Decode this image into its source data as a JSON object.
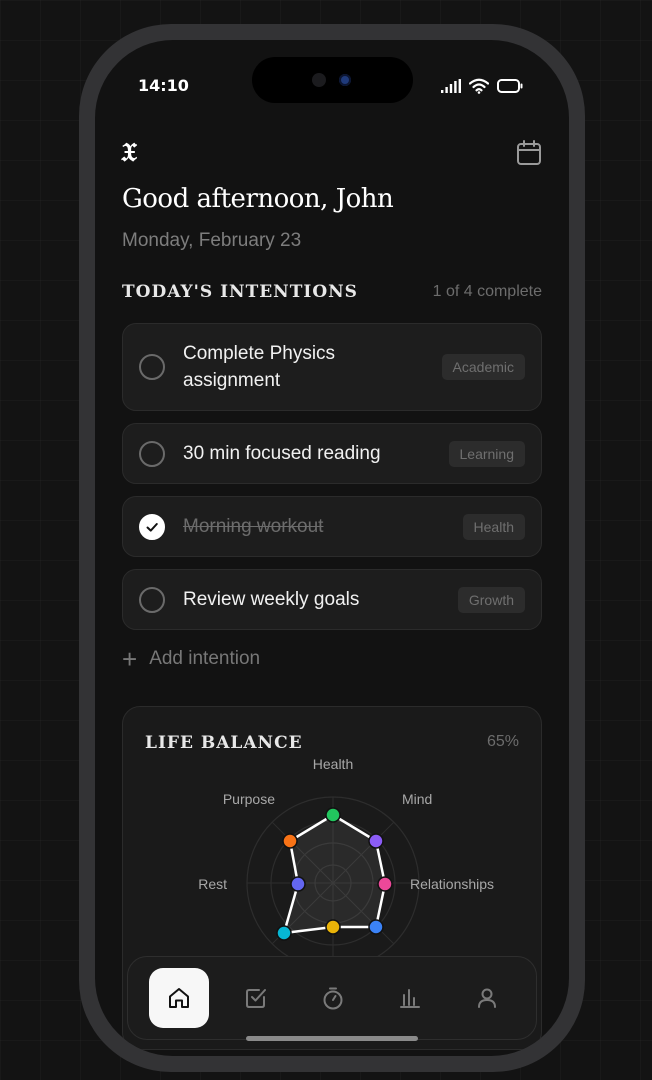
{
  "status": {
    "time": "14:10"
  },
  "header": {
    "logo": "𝔛",
    "greeting": "Good afternoon, John",
    "date": "Monday, February 23",
    "calendar_icon": "calendar-icon"
  },
  "intentions": {
    "title": "TODAY'S INTENTIONS",
    "progress": "1 of 4 complete",
    "items": [
      {
        "line1": "Complete Physics",
        "line2": "assignment",
        "tag": "Academic",
        "done": false
      },
      {
        "line1": "30 min focused reading",
        "tag": "Learning",
        "done": false
      },
      {
        "line1": "Morning workout",
        "tag": "Health",
        "done": true
      },
      {
        "line1": "Review weekly goals",
        "tag": "Growth",
        "done": false
      }
    ],
    "add_label": "Add intention"
  },
  "balance": {
    "title": "LIFE BALANCE",
    "percent": "65%",
    "labels": {
      "health": "Health",
      "mind": "Mind",
      "relationships": "Relationships",
      "rest": "Rest",
      "purpose": "Purpose"
    },
    "colors": {
      "health": "#22c55e",
      "mind": "#8b5cf6",
      "relationships": "#ec4899",
      "bottom_right": "#3b82f6",
      "bottom": "#eab308",
      "bottom_left": "#06b6d4",
      "rest": "#6366f1",
      "purpose": "#f97316"
    }
  },
  "nav": {
    "items": [
      "home-icon",
      "checkbox-icon",
      "timer-icon",
      "chart-icon",
      "profile-icon"
    ],
    "active": "home-icon"
  }
}
